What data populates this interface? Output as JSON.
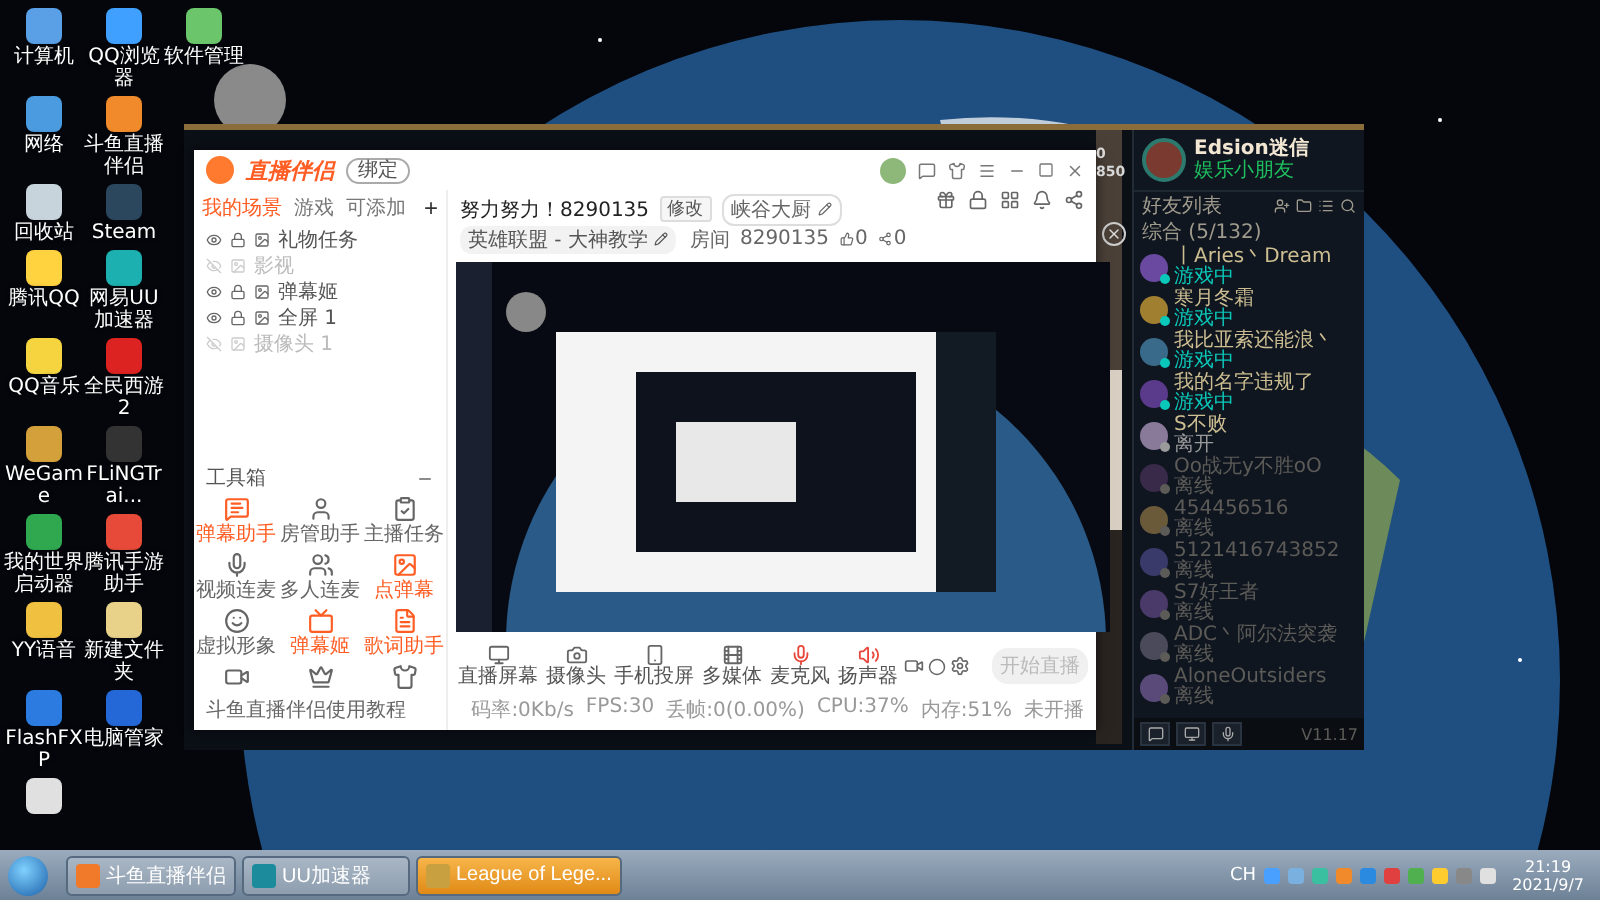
{
  "desktop_icon_rows": [
    [
      {
        "label": "计算机"
      },
      {
        "label": "QQ浏览器"
      },
      {
        "label": "软件管理"
      }
    ],
    [
      {
        "label": "网络"
      },
      {
        "label": "斗鱼直播伴侣"
      }
    ],
    [
      {
        "label": "回收站"
      },
      {
        "label": "Steam"
      }
    ],
    [
      {
        "label": "腾讯QQ"
      },
      {
        "label": "网易UU加速器"
      }
    ],
    [
      {
        "label": "QQ音乐"
      },
      {
        "label": "全民西游2"
      }
    ],
    [
      {
        "label": "WeGame"
      },
      {
        "label": "FLiNGTrai..."
      }
    ],
    [
      {
        "label": "我的世界启动器"
      },
      {
        "label": "腾讯手游助手"
      }
    ],
    [
      {
        "label": "YY语音"
      },
      {
        "label": "新建文件夹"
      }
    ],
    [
      {
        "label": "FlashFXP"
      },
      {
        "label": "电脑管家"
      }
    ],
    [
      {}
    ]
  ],
  "game_client": {
    "stats": [
      "0",
      "850"
    ],
    "profile": {
      "name": "Edsion迷信",
      "status": "娱乐小朋友"
    },
    "friends_title": "好友列表",
    "group": "综合 (5/132)",
    "friends": [
      {
        "name": "丨Aries丶Dream",
        "status": "游戏中",
        "kind": "in_game"
      },
      {
        "name": "寒月冬霜",
        "status": "游戏中",
        "kind": "in_game"
      },
      {
        "name": "我比亚索还能浪丶",
        "status": "游戏中",
        "kind": "in_game"
      },
      {
        "name": "我的名字违规了",
        "status": "游戏中",
        "kind": "in_game"
      },
      {
        "name": "S不败",
        "status": "离开",
        "kind": "away"
      },
      {
        "name": "Oo战无y不胜oO",
        "status": "离线",
        "kind": "offline"
      },
      {
        "name": "454456516",
        "status": "离线",
        "kind": "offline"
      },
      {
        "name": "5121416743852",
        "status": "离线",
        "kind": "offline"
      },
      {
        "name": "S7好王者",
        "status": "离线",
        "kind": "offline"
      },
      {
        "name": "ADC丶阿尔法突袭",
        "status": "离线",
        "kind": "offline"
      },
      {
        "name": "AloneOutsiders",
        "status": "离线",
        "kind": "offline"
      }
    ],
    "version": "V11.17"
  },
  "app": {
    "logo": "直播伴侣",
    "badge": "绑定",
    "tabs": [
      {
        "label": "我的场景",
        "selected": true
      },
      {
        "label": "游戏",
        "selected": false
      },
      {
        "label": "可添加",
        "selected": false
      }
    ],
    "add": "+",
    "sources": [
      {
        "label": "礼物任务",
        "visible": true
      },
      {
        "label": "影视",
        "visible": false
      },
      {
        "label": "弹幕姬",
        "visible": true
      },
      {
        "label": "全屏 1",
        "visible": true
      },
      {
        "label": "摄像头 1",
        "visible": false
      }
    ],
    "toolbox_title": "工具箱",
    "tools": [
      {
        "label": "弹幕助手",
        "highlighted": true
      },
      {
        "label": "房管助手",
        "highlighted": false
      },
      {
        "label": "主播任务",
        "highlighted": false
      },
      {
        "label": "视频连麦",
        "highlighted": false
      },
      {
        "label": "多人连麦",
        "highlighted": false
      },
      {
        "label": "点弹幕",
        "highlighted": true
      },
      {
        "label": "虚拟形象",
        "highlighted": false
      },
      {
        "label": "弹幕姬",
        "highlighted": true
      },
      {
        "label": "歌词助手",
        "highlighted": true
      },
      {
        "highlighted": false
      },
      {
        "highlighted": false
      },
      {
        "highlighted": false
      }
    ],
    "notice": "斗鱼直播伴侣使用教程",
    "room_title": "努力努力！8290135",
    "edit_button": "修改",
    "nickname": "峡谷大厨",
    "category": "英雄联盟 - 大神教学",
    "room_label": "房间",
    "room_id": "8290135",
    "likes": "0",
    "shares": "0",
    "controls": [
      {
        "label": "直播屏幕",
        "active": false
      },
      {
        "label": "摄像头",
        "active": false
      },
      {
        "label": "手机投屏",
        "active": false
      },
      {
        "label": "多媒体",
        "active": false
      },
      {
        "label": "麦克风",
        "active": true
      },
      {
        "label": "扬声器",
        "active": true
      }
    ],
    "start_button": {
      "label": "开始直播",
      "disabled": true
    },
    "status": [
      "码率:0Kb/s",
      "FPS:30",
      "丢帧:0(0.00%)",
      "CPU:37%",
      "内存:51%",
      "未开播"
    ]
  },
  "taskbar": {
    "tasks": [
      {
        "label": "斗鱼直播伴侣",
        "selected": false
      },
      {
        "label": "UU加速器",
        "selected": false
      },
      {
        "label": "League of Lege...",
        "selected": true
      }
    ],
    "language": "CH",
    "time": "21:19",
    "date": "2021/9/7"
  }
}
